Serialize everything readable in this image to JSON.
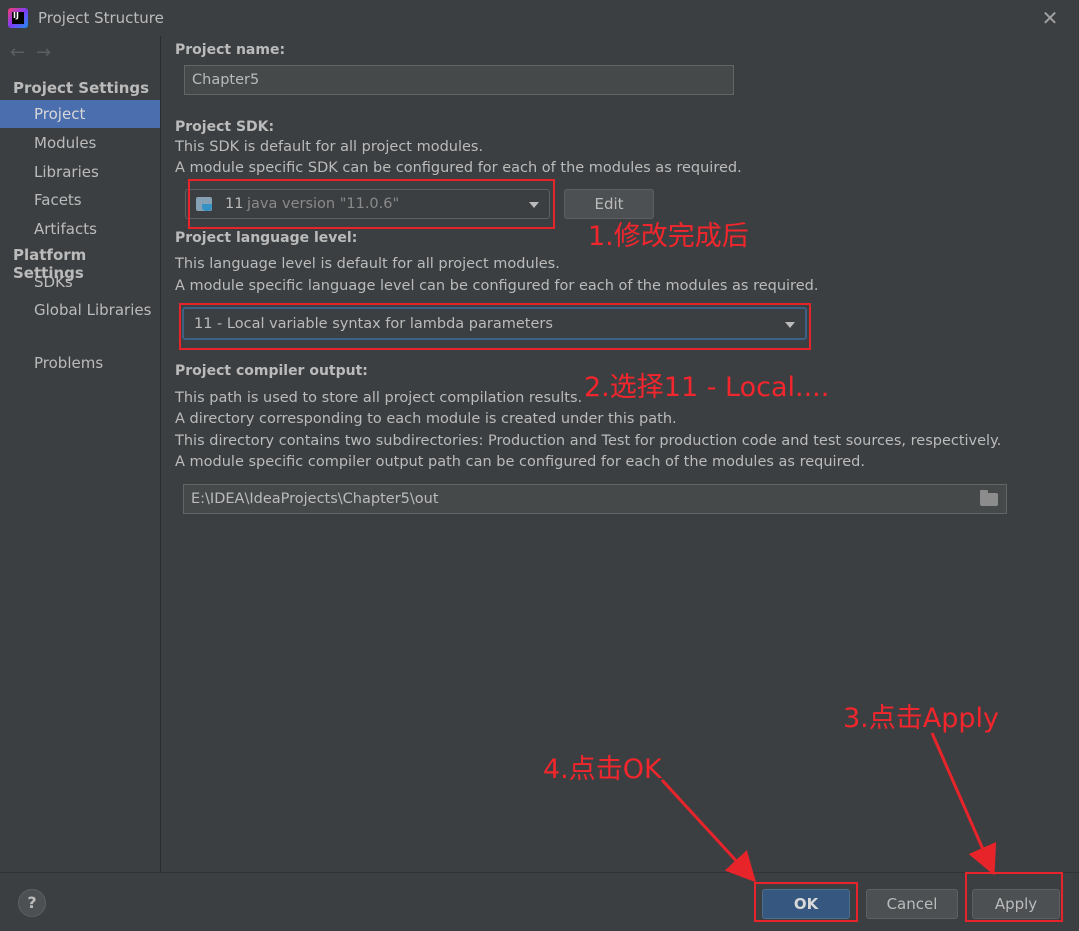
{
  "window": {
    "title": "Project Structure",
    "app_icon_text": "IJ"
  },
  "sidebar": {
    "project_settings_header": "Project Settings",
    "project_settings_items": [
      "Project",
      "Modules",
      "Libraries",
      "Facets",
      "Artifacts"
    ],
    "platform_settings_header": "Platform Settings",
    "platform_settings_items": [
      "SDKs",
      "Global Libraries"
    ],
    "problems_label": "Problems",
    "selected": "Project"
  },
  "main": {
    "project_name_label": "Project name:",
    "project_name_value": "Chapter5",
    "sdk_label": "Project SDK:",
    "sdk_desc_1": "This SDK is default for all project modules.",
    "sdk_desc_2": "A module specific SDK can be configured for each of the modules as required.",
    "sdk_value_number": "11",
    "sdk_value_detail": "java version \"11.0.6\"",
    "edit_button": "Edit",
    "lang_label": "Project language level:",
    "lang_desc_1": "This language level is default for all project modules.",
    "lang_desc_2": "A module specific language level can be configured for each of the modules as required.",
    "lang_value": "11 - Local variable syntax for lambda parameters",
    "output_label": "Project compiler output:",
    "output_desc_1": "This path is used to store all project compilation results.",
    "output_desc_2": "A directory corresponding to each module is created under this path.",
    "output_desc_3": "This directory contains two subdirectories: Production and Test for production code and test sources, respectively.",
    "output_desc_4": "A module specific compiler output path can be configured for each of the modules as required.",
    "output_path": "E:\\IDEA\\IdeaProjects\\Chapter5\\out"
  },
  "footer": {
    "help": "?",
    "ok": "OK",
    "cancel": "Cancel",
    "apply": "Apply"
  },
  "annotations": {
    "step1": "1.修改完成后",
    "step2": "2.选择11 - Local....",
    "step3": "3.点击Apply",
    "step4": "4.点击OK",
    "color": "#e8242b"
  }
}
